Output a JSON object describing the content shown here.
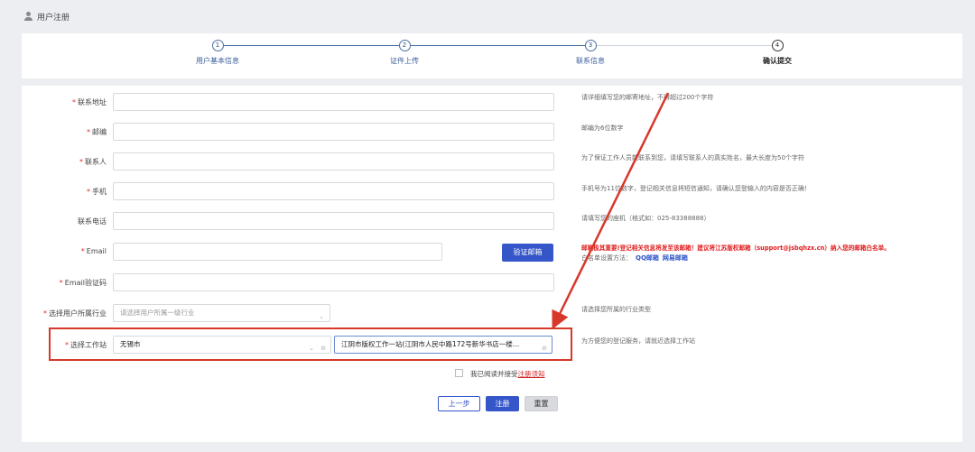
{
  "header": {
    "title": "用户注册"
  },
  "steps": [
    {
      "num": "1",
      "label": "用户基本信息"
    },
    {
      "num": "2",
      "label": "证件上传"
    },
    {
      "num": "3",
      "label": "联系信息"
    },
    {
      "num": "4",
      "label": "确认提交"
    }
  ],
  "form": {
    "address": {
      "label": "联系地址",
      "hint": "请详细填写您的邮寄地址，不得超过200个字符"
    },
    "postcode": {
      "label": "邮编",
      "hint": "邮编为6位数字"
    },
    "contact": {
      "label": "联系人",
      "hint": "为了保证工作人员能联系到您，请填写联系人的真实姓名，最大长度为50个字符"
    },
    "mobile": {
      "label": "手机",
      "hint": "手机号为11位数字，登记相关信息将短信通知，请确认您登输入的内容是否正确！"
    },
    "phone": {
      "label": "联系电话",
      "hint": "请填写您的座机（格式如：025-83388888）"
    },
    "email": {
      "label": "Email",
      "verify_button": "验证邮箱",
      "hint_red": "邮箱极其重要!登记相关信息将发至该邮箱！建议将江苏版权邮箱（support@jsbqhzx.cn）纳入您的邮箱白名单。",
      "whitelist_prefix": "白名单设置方法：",
      "qq_link": "QQ邮箱",
      "netease_link": "网易邮箱"
    },
    "email_code": {
      "label": "Email验证码"
    },
    "industry": {
      "label": "选择用户所属行业",
      "placeholder": "请选择用户所属一级行业",
      "hint": "请选择您所属的行业类型"
    },
    "workstation": {
      "label": "选择工作站",
      "city": "无锡市",
      "station": "江阴市版权工作一站(江阴市人民中路172号新华书店一楼…",
      "hint": "为方便您的登记服务，请就近选择工作站"
    }
  },
  "agree": {
    "text": "我已阅读并接受",
    "link": "注册须知"
  },
  "buttons": {
    "prev": "上一步",
    "submit": "注册",
    "reset": "重置"
  },
  "colors": {
    "primary": "#3456c9",
    "annotation": "#d7382a"
  }
}
